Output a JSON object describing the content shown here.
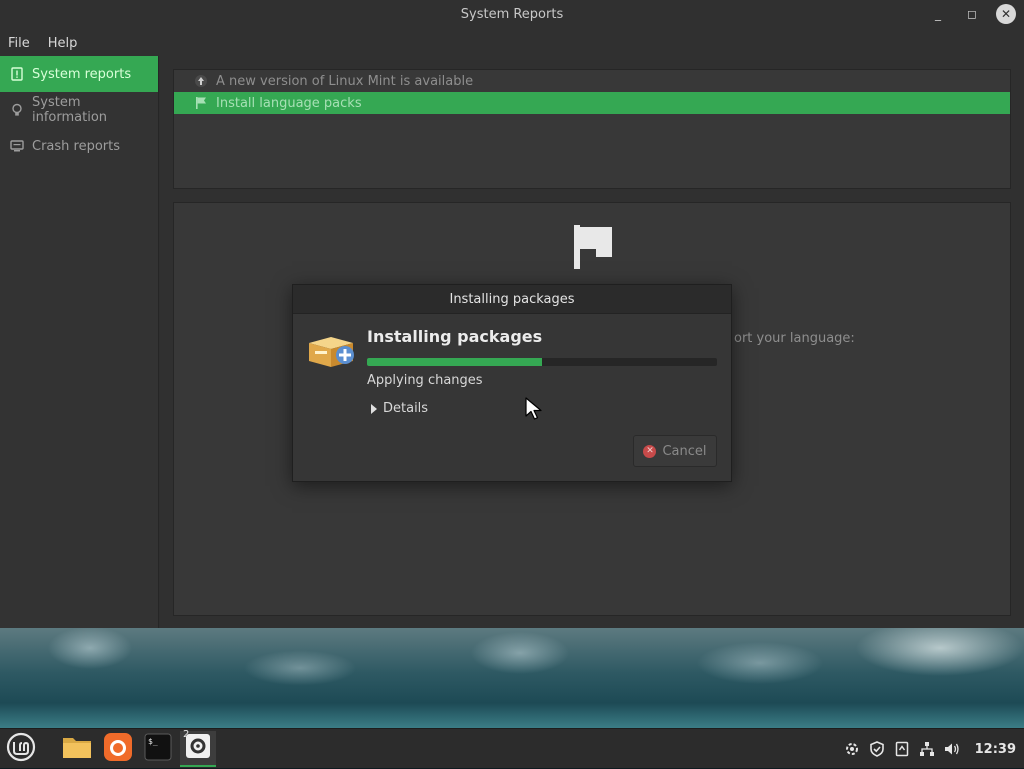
{
  "window": {
    "title": "System Reports"
  },
  "menu": [
    {
      "label": "File"
    },
    {
      "label": "Help"
    }
  ],
  "sidebar": {
    "items": [
      {
        "label": "System reports",
        "icon": "report-icon",
        "active": true
      },
      {
        "label": "System information",
        "icon": "lightbulb-icon",
        "active": false
      },
      {
        "label": "Crash reports",
        "icon": "monitor-icon",
        "active": false
      }
    ]
  },
  "reports": {
    "items": [
      {
        "label": "A new version of Linux Mint is available",
        "icon": "up-arrow-icon",
        "selected": false
      },
      {
        "label": "Install language packs",
        "icon": "flag-icon",
        "selected": true
      }
    ],
    "detail_text": "ort your language:"
  },
  "dialog": {
    "title": "Installing packages",
    "heading": "Installing packages",
    "progress": 0.5,
    "status": "Applying changes",
    "details_label": "Details",
    "cancel_label": "Cancel"
  },
  "taskbar": {
    "apps": [
      {
        "name": "menu",
        "icon": "mint-logo-icon"
      },
      {
        "name": "files",
        "icon": "folder-icon"
      },
      {
        "name": "firefox",
        "icon": "firefox-icon"
      },
      {
        "name": "terminal",
        "icon": "terminal-icon"
      },
      {
        "name": "system-reports",
        "icon": "gear-icon",
        "badge": "2",
        "active": true
      }
    ],
    "clock": "12:39"
  },
  "colors": {
    "accent": "#35a853",
    "window_bg": "#303030",
    "panel_bg": "#383838"
  }
}
